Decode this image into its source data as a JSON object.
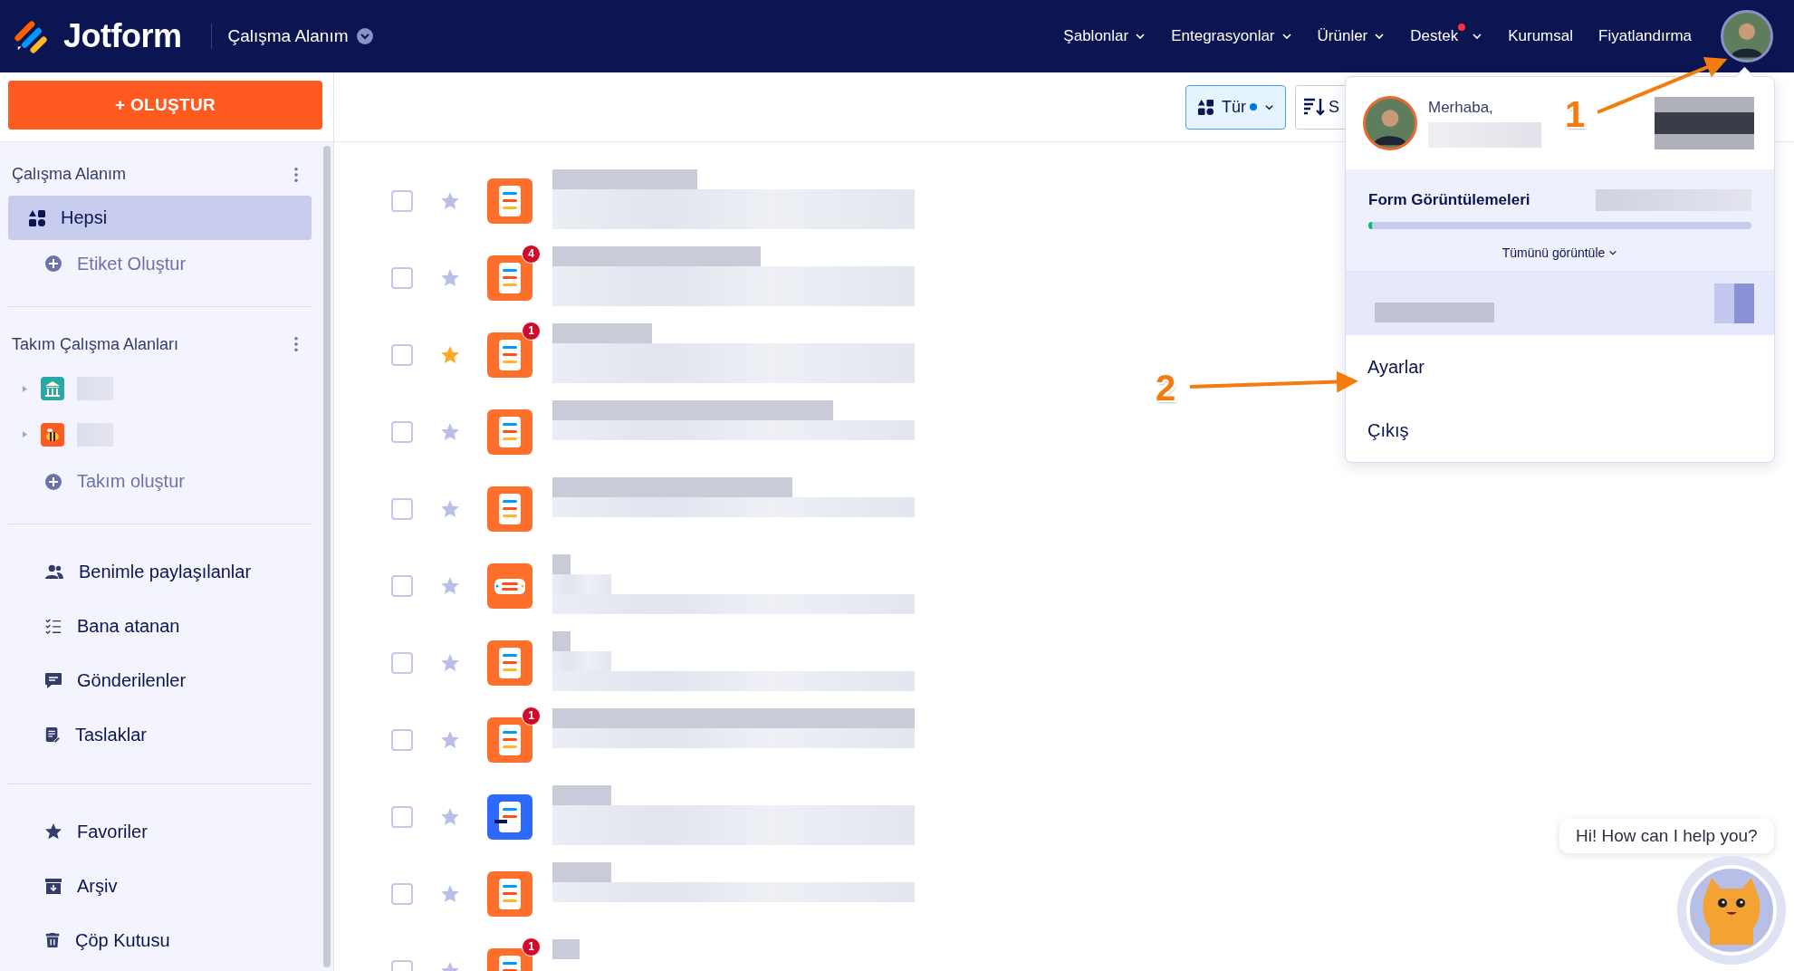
{
  "topbar": {
    "logo": "Jotform",
    "workspace": "Çalışma Alanım",
    "nav": [
      {
        "label": "Şablonlar",
        "dropdown": true,
        "dot": false
      },
      {
        "label": "Entegrasyonlar",
        "dropdown": true,
        "dot": false
      },
      {
        "label": "Ürünler",
        "dropdown": true,
        "dot": false
      },
      {
        "label": "Destek",
        "dropdown": true,
        "dot": true
      },
      {
        "label": "Kurumsal",
        "dropdown": false,
        "dot": false
      },
      {
        "label": "Fiyatlandırma",
        "dropdown": false,
        "dot": false
      }
    ]
  },
  "sidebar": {
    "create_button": "+ OLUŞTUR",
    "workspace_header": "Çalışma Alanım",
    "workspace_items": [
      {
        "label": "Hepsi",
        "kind": "grid",
        "selected": true
      },
      {
        "label": "Etiket Oluştur",
        "kind": "plus",
        "selected": false
      }
    ],
    "teams_header": "Takım Çalışma Alanları",
    "teams": [
      {
        "kind": "museum",
        "expanded": false
      },
      {
        "kind": "bee",
        "expanded": false
      }
    ],
    "create_team": "Takım oluştur",
    "groups": [
      [
        {
          "label": "Benimle paylaşılanlar",
          "kind": "people",
          "selected": false
        },
        {
          "label": "Bana atanan",
          "kind": "checklist",
          "selected": false
        },
        {
          "label": "Gönderilenler",
          "kind": "chat",
          "selected": false
        },
        {
          "label": "Taslaklar",
          "kind": "draft",
          "selected": false
        }
      ],
      [
        {
          "label": "Favoriler",
          "kind": "star",
          "selected": false
        },
        {
          "label": "Arşiv",
          "kind": "archive",
          "selected": false
        },
        {
          "label": "Çöp Kutusu",
          "kind": "trash",
          "selected": false
        }
      ]
    ]
  },
  "toolbar": {
    "type_button": "Tür",
    "type_filter_active": true,
    "sort_button": "S"
  },
  "forms": [
    {
      "checked": false,
      "starred": false,
      "kind": "form"
    },
    {
      "checked": false,
      "starred": false,
      "kind": "form",
      "badge": "4"
    },
    {
      "checked": false,
      "starred": true,
      "kind": "form",
      "badge": "1"
    },
    {
      "checked": false,
      "starred": false,
      "kind": "form"
    },
    {
      "checked": false,
      "starred": false,
      "kind": "form"
    },
    {
      "checked": false,
      "starred": false,
      "kind": "card"
    },
    {
      "checked": false,
      "starred": false,
      "kind": "form"
    },
    {
      "checked": false,
      "starred": false,
      "kind": "form",
      "badge": "1"
    },
    {
      "checked": false,
      "starred": false,
      "kind": "document"
    },
    {
      "checked": false,
      "starred": false,
      "kind": "form"
    },
    {
      "checked": false,
      "starred": false,
      "kind": "form",
      "badge": "1"
    }
  ],
  "account_menu": {
    "greeting": "Merhaba,",
    "usage_label": "Form Görüntülemeleri",
    "level": 0.01,
    "view_all": "Tümünü görüntüle",
    "items": [
      "Ayarlar",
      "Çıkış"
    ]
  },
  "annotations": [
    {
      "number": "1"
    },
    {
      "number": "2"
    }
  ],
  "chat": {
    "message": "Hi! How can I help you?"
  }
}
